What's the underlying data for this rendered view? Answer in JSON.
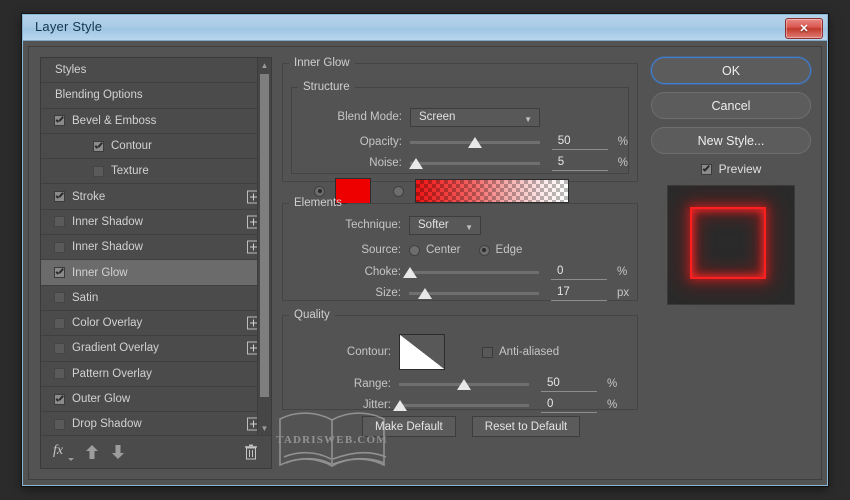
{
  "window": {
    "title": "Layer Style",
    "close_label": "✕"
  },
  "styles_panel": {
    "items": [
      {
        "label": "Styles",
        "type": "plain",
        "checked": null,
        "plus": false,
        "selected": false,
        "indent": false
      },
      {
        "label": "Blending Options",
        "type": "plain",
        "checked": null,
        "plus": false,
        "selected": false,
        "indent": false
      },
      {
        "label": "Bevel & Emboss",
        "type": "check",
        "checked": true,
        "plus": false,
        "selected": false,
        "indent": false
      },
      {
        "label": "Contour",
        "type": "check",
        "checked": true,
        "plus": false,
        "selected": false,
        "indent": true
      },
      {
        "label": "Texture",
        "type": "check",
        "checked": false,
        "plus": false,
        "selected": false,
        "indent": true
      },
      {
        "label": "Stroke",
        "type": "check",
        "checked": true,
        "plus": true,
        "selected": false,
        "indent": false
      },
      {
        "label": "Inner Shadow",
        "type": "check",
        "checked": false,
        "plus": true,
        "selected": false,
        "indent": false
      },
      {
        "label": "Inner Shadow",
        "type": "check",
        "checked": false,
        "plus": true,
        "selected": false,
        "indent": false
      },
      {
        "label": "Inner Glow",
        "type": "check",
        "checked": true,
        "plus": false,
        "selected": true,
        "indent": false
      },
      {
        "label": "Satin",
        "type": "check",
        "checked": false,
        "plus": false,
        "selected": false,
        "indent": false
      },
      {
        "label": "Color Overlay",
        "type": "check",
        "checked": false,
        "plus": true,
        "selected": false,
        "indent": false
      },
      {
        "label": "Gradient Overlay",
        "type": "check",
        "checked": false,
        "plus": true,
        "selected": false,
        "indent": false
      },
      {
        "label": "Pattern Overlay",
        "type": "check",
        "checked": false,
        "plus": false,
        "selected": false,
        "indent": false
      },
      {
        "label": "Outer Glow",
        "type": "check",
        "checked": true,
        "plus": false,
        "selected": false,
        "indent": false
      },
      {
        "label": "Drop Shadow",
        "type": "check",
        "checked": false,
        "plus": true,
        "selected": false,
        "indent": false
      }
    ],
    "footer": {
      "fx_label": "fx",
      "up_icon": "arrow-up-icon",
      "down_icon": "arrow-down-icon",
      "trash_icon": "trash-icon"
    }
  },
  "panel": {
    "section_title": "Inner Glow",
    "structure": {
      "legend": "Structure",
      "blend_mode_label": "Blend Mode:",
      "blend_mode_value": "Screen",
      "opacity_label": "Opacity:",
      "opacity_value": "50",
      "opacity_unit": "%",
      "noise_label": "Noise:",
      "noise_value": "5",
      "noise_unit": "%",
      "color_selected": true,
      "color_hex": "#ee0000",
      "gradient_selected": false
    },
    "elements": {
      "legend": "Elements",
      "technique_label": "Technique:",
      "technique_value": "Softer",
      "source_label": "Source:",
      "source_center_label": "Center",
      "source_edge_label": "Edge",
      "source_value": "Edge",
      "choke_label": "Choke:",
      "choke_value": "0",
      "choke_unit": "%",
      "size_label": "Size:",
      "size_value": "17",
      "size_unit": "px"
    },
    "quality": {
      "legend": "Quality",
      "contour_label": "Contour:",
      "anti_aliased_label": "Anti-aliased",
      "anti_aliased_checked": false,
      "range_label": "Range:",
      "range_value": "50",
      "range_unit": "%",
      "jitter_label": "Jitter:",
      "jitter_value": "0",
      "jitter_unit": "%"
    },
    "buttons": {
      "make_default": "Make Default",
      "reset_to_default": "Reset to Default"
    },
    "watermark_text": "TADRISWEB.COM"
  },
  "right_panel": {
    "ok": "OK",
    "cancel": "Cancel",
    "new_style": "New Style...",
    "preview_label": "Preview",
    "preview_checked": true
  }
}
